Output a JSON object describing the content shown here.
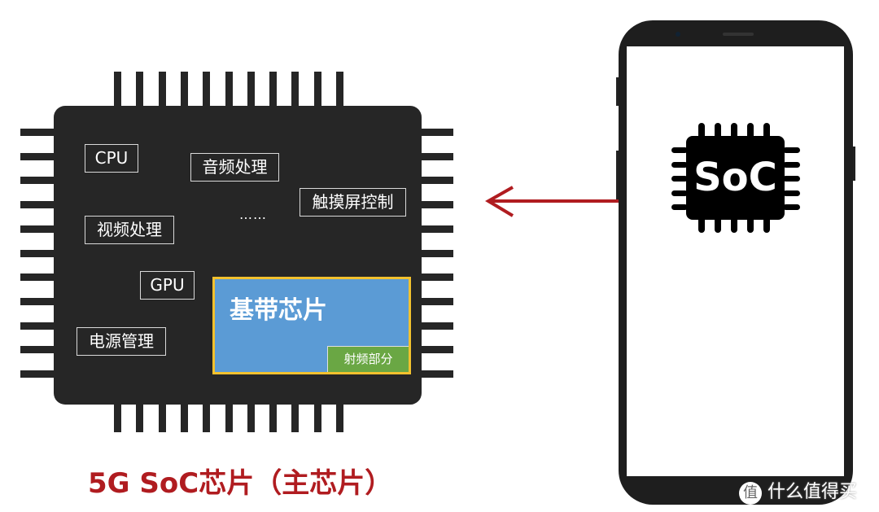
{
  "soc_chip": {
    "blocks": [
      "CPU",
      "音频处理",
      "触摸屏控制",
      "视频处理",
      "GPU",
      "电源管理"
    ],
    "ellipsis": "……",
    "baseband": {
      "label": "基带芯片",
      "rf_label": "射频部分"
    },
    "caption": "5G SoC芯片（主芯片）"
  },
  "phone": {
    "chip_label": "SoC"
  },
  "watermark": {
    "icon_char": "值",
    "text": "什么值得买"
  },
  "colors": {
    "chip": "#262626",
    "baseband": "#5b9bd5",
    "baseband_border": "#f2c12e",
    "rf": "#6aa744",
    "arrow": "#b01c20",
    "caption": "#b01c20"
  }
}
